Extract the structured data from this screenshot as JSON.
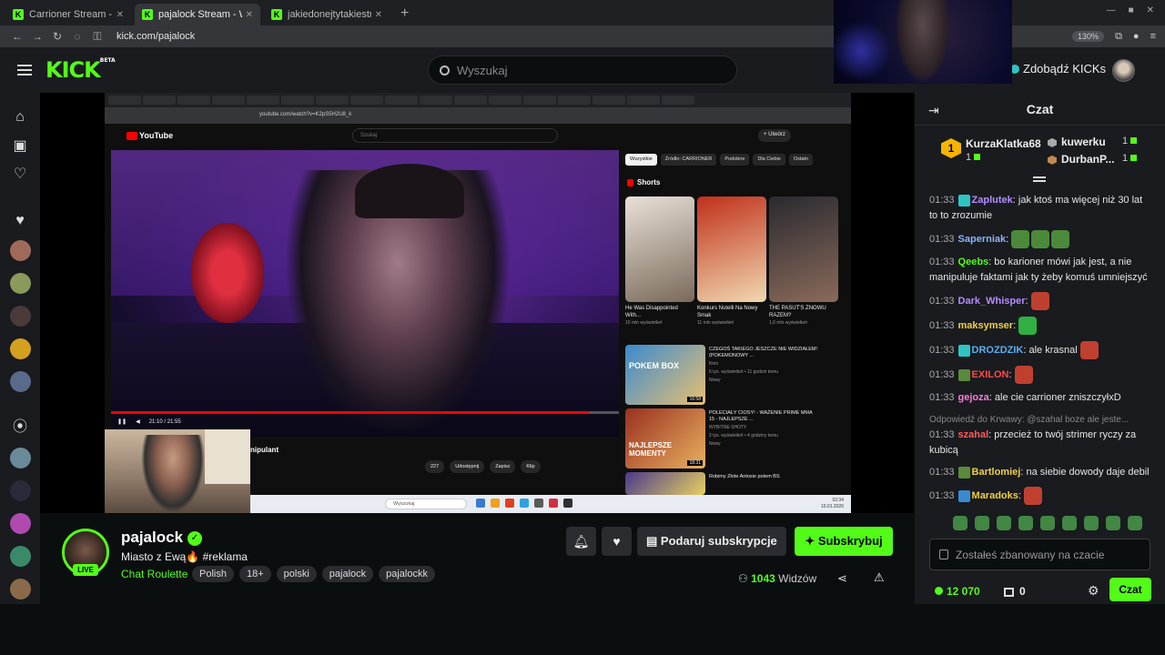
{
  "browser": {
    "tabs": [
      {
        "label": "Carrioner Stream - W",
        "active": false
      },
      {
        "label": "pajalock Stream - W",
        "active": true
      },
      {
        "label": "jakiedonejtytakiestrimy",
        "active": false
      }
    ],
    "new_tab": "+",
    "url": "kick.com/pajalock",
    "zoom": "130%"
  },
  "header": {
    "logo": "KICK",
    "logo_beta": "BETA",
    "search_placeholder": "Wyszukaj",
    "get_kicks": "Zdobądź KICKs"
  },
  "sidebar": {
    "icons": [
      "home-icon",
      "following-icon",
      "heart-icon",
      "heart-filled-icon",
      "broadcast-icon"
    ]
  },
  "video": {
    "youtube": {
      "logo": "YouTube",
      "url": "youtube.com/watch?v=K2pS5H2U8_k",
      "search_placeholder": "Szukaj",
      "create": "+ Utwórz",
      "time": "21:10 / 21:55",
      "progress": 0.94,
      "chips": [
        "Wszystkie",
        "Źródło: CARRIONER",
        "Podobne",
        "Dla Ciebie",
        "Ostatn"
      ],
      "shorts_label": "Shorts",
      "shorts": [
        {
          "title": "He Was Disappointed With...",
          "views": "10 mln wyświetleń"
        },
        {
          "title": "Konkurs Nutelli Na Nowy Smak",
          "views": "11 mln wyświetleń"
        },
        {
          "title": "THE PASUT'S ZNOWU RAZEM?",
          "views": "1,6 mln wyświetleń"
        }
      ],
      "recs": [
        {
          "title": "CZEGOŚ TAKIEGO JESZCZE NIE WIDZIAŁEM! (POKEMONOWY ...",
          "channel": "Kimi",
          "meta": "6 tys. wyświetleń • 11 godzin temu",
          "badge": "Nowy",
          "duration": "16:58",
          "thumb_text": "POKEM BOX"
        },
        {
          "title": "POLECIAŁY CIOSY! - WAŻENIE PRIME MMA 15 - NAJLEPSZE ...",
          "channel": "WYBITNE SHOTY",
          "meta": "2 tys. wyświetleń • 4 godziny temu",
          "badge": "Nowy",
          "duration": "18:31",
          "thumb_text": "NAJLEPSZE MOMENTY"
        },
        {
          "title": "Robimy Złote Antosie potem BS",
          "channel": "",
          "meta": "",
          "badge": "",
          "duration": "",
          "thumb_text": ""
        }
      ],
      "video_title_partial": "nipulant",
      "actions": [
        "227",
        "Udostępnij",
        "Zapisz",
        "Klip"
      ],
      "taskbar_search": "Wyszukaj",
      "clock": "02:34\n10.01.2026"
    }
  },
  "stream": {
    "streamer": "pajalock",
    "live": "LIVE",
    "title": "Miasto z Ewą🔥 #reklama",
    "category": "Chat Roulette",
    "tags": [
      "Polish",
      "18+",
      "polski",
      "pajalock",
      "pajalockk"
    ],
    "gift_subs": "Podaruj subskrypcje",
    "subscribe": "Subskrybuj",
    "viewers_count": "1043",
    "viewers_label": "Widzów"
  },
  "chat": {
    "title": "Czat",
    "leaderboard": [
      {
        "rank": "1",
        "name": "KurzaKlatka68",
        "value": "1"
      },
      {
        "name": "kuwerku",
        "value": "1"
      },
      {
        "name": "DurbanP...",
        "value": "1"
      }
    ],
    "messages": [
      {
        "time": "01:33",
        "user": "Zaplutek",
        "color": "#b48cff",
        "text": "jak ktoś ma więcej niż 30 lat to to zrozumie",
        "badge": "#2ec4c4"
      },
      {
        "time": "01:33",
        "user": "Saperniak",
        "color": "#8ab4f8",
        "text": "",
        "emotes": 3,
        "emote_color": "#4a8a3a"
      },
      {
        "time": "01:33",
        "user": "Qeebs",
        "color": "#53fc18",
        "text": "bo karioner mówi jak jest, a nie manipuluje faktami jak ty żeby komuś umniejszyć"
      },
      {
        "time": "01:33",
        "user": "Dark_Whisper",
        "color": "#b48cff",
        "text": "",
        "emotes": 1,
        "emote_color": "#c04030"
      },
      {
        "time": "01:33",
        "user": "maksymser",
        "color": "#f0d040",
        "text": "",
        "emotes": 1,
        "emote_color": "#30b040"
      },
      {
        "time": "01:33",
        "user": "DROZDZIK",
        "color": "#5ab0f0",
        "text": "ale krasnal",
        "badge": "#2ec4c4",
        "emotes_after": 1,
        "emote_color": "#c04030"
      },
      {
        "time": "01:33",
        "user": "EXILON",
        "color": "#ff4a4a",
        "text": "",
        "badge": "#5a8a3a",
        "emotes": 1,
        "emote_color": "#c04030"
      },
      {
        "time": "01:33",
        "user": "gejoza",
        "color": "#ff7ad8",
        "text": "ale cie carrioner zniszczyłxD"
      },
      {
        "time": "01:33",
        "user": "szahal",
        "color": "#ff5a5a",
        "text": "przecież to twój strimer ryczy za kubicą",
        "reply": "Odpowiedź do Krwawy: @szahal boze ale jeste..."
      },
      {
        "time": "01:33",
        "user": "Bartlomiej",
        "color": "#f0d040",
        "text": "na siebie dowody daje debil",
        "badge": "#5a8a3a"
      },
      {
        "time": "01:33",
        "user": "Maradoks",
        "color": "#f0d040",
        "text": "",
        "badge": "#3a8ad0",
        "emotes": 1,
        "emote_color": "#c04030"
      }
    ],
    "input_placeholder": "Zostałeś zbanowany na czacie",
    "points": "12 070",
    "gifts": "0",
    "send_button": "Czat"
  }
}
